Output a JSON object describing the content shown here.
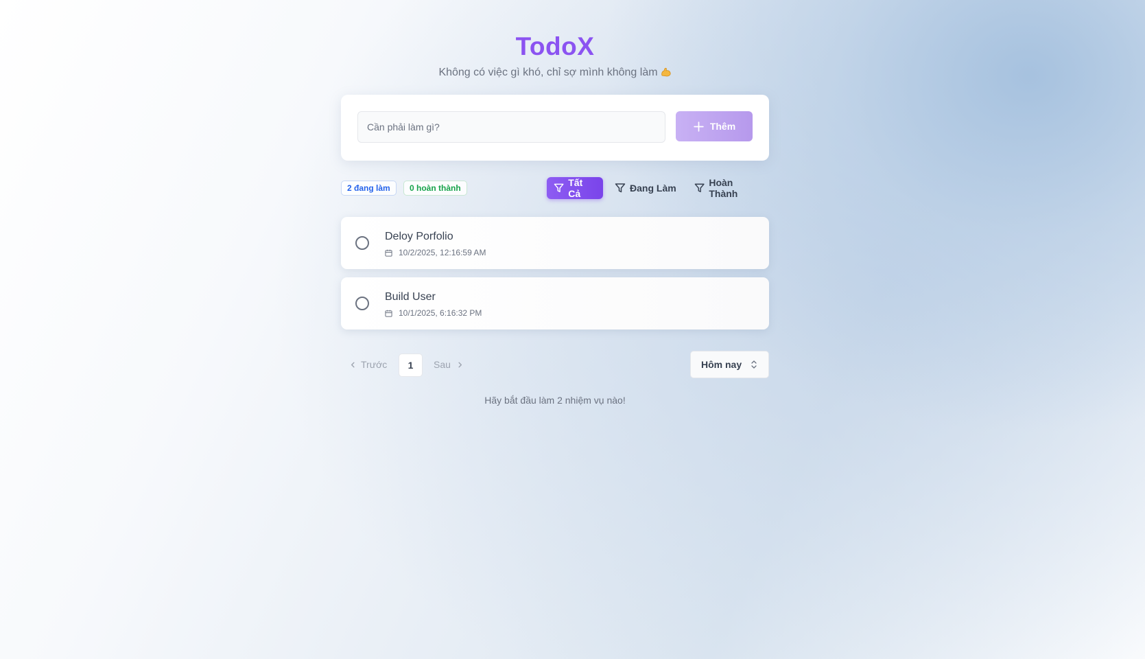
{
  "app": {
    "title": "TodoX",
    "subtitle": "Không có việc gì khó, chỉ sợ mình không làm"
  },
  "add_form": {
    "placeholder": "Cần phải làm gì?",
    "value": "",
    "button_label": "Thêm"
  },
  "stats": {
    "active_label": "2 đang làm",
    "completed_label": "0 hoàn thành"
  },
  "filters": [
    {
      "label": "Tất Cả",
      "selected": true
    },
    {
      "label": "Đang Làm",
      "selected": false
    },
    {
      "label": "Hoàn Thành",
      "selected": false
    }
  ],
  "tasks": [
    {
      "title": "Deloy Porfolio",
      "date": "10/2/2025, 12:16:59 AM",
      "completed": false
    },
    {
      "title": "Build User",
      "date": "10/1/2025, 6:16:32 PM",
      "completed": false
    }
  ],
  "pagination": {
    "prev_label": "Trước",
    "current_page": "1",
    "next_label": "Sau"
  },
  "date_filter": {
    "selected": "Hôm nay"
  },
  "footer": {
    "message": "Hãy bắt đầu làm 2 nhiệm vụ nào!"
  },
  "colors": {
    "brand": "#8b53f1",
    "active_badge": "#2563eb",
    "completed_badge": "#16a34a"
  },
  "icons": {
    "subtitle_emoji": "flexed-biceps-icon",
    "add": "plus-icon",
    "filter": "funnel-icon",
    "task_date": "calendar-icon",
    "prev": "chevron-left-icon",
    "next": "chevron-right-icon",
    "select": "chevrons-up-down-icon"
  }
}
